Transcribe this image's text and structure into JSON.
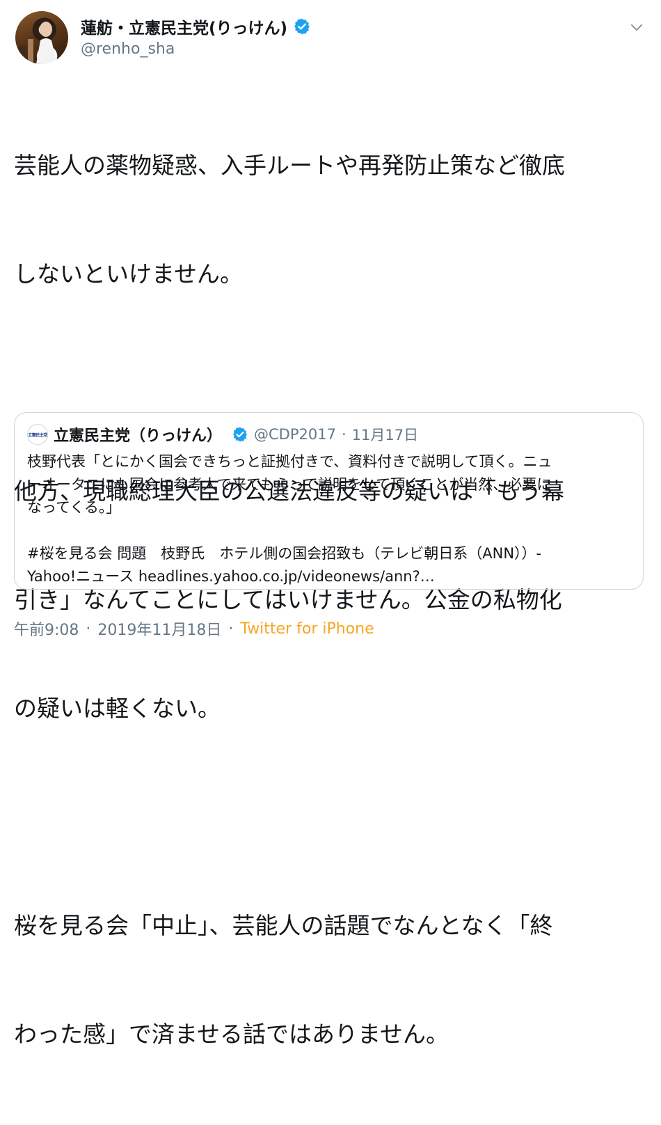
{
  "author": {
    "display_name": "蓮舫・立憲民主党(りっけん)",
    "handle": "@renho_sha"
  },
  "tweet": {
    "paragraphs": [
      [
        "芸能人の薬物疑惑、入手ルートや再発防止策など徹底",
        "しないといけません。"
      ],
      [
        "他方、現職総理大臣の公選法違反等の疑いは「もう幕",
        "引き」なんてことにしてはいけません。公金の私物化",
        "の疑いは軽くない。"
      ],
      [
        "桜を見る会「中止」、芸能人の話題でなんとなく「終",
        "わった感」で済ませる話ではありません。"
      ]
    ]
  },
  "quote": {
    "avatar_text": "立憲民主党",
    "display_name": "立憲民主党（りっけん）",
    "handle": "@CDP2017",
    "separator": "·",
    "date": "11月17日",
    "lines": [
      "枝野代表「とにかく国会できちっと証拠付きで、資料付きで説明して頂く。ニュ",
      "ーオータニにも国会に参考人で来てもらって説明をして頂くことが当然、必要に",
      "なってくる。」",
      "",
      "#桜を見る会 問題　枝野氏　ホテル側の国会招致も（テレビ朝日系（ANN））‐",
      "Yahoo!ニュース headlines.yahoo.co.jp/videonews/ann?…"
    ]
  },
  "footer": {
    "time": "午前9:08",
    "separator": "·",
    "date": "2019年11月18日",
    "separator2": "·",
    "source": "Twitter for iPhone"
  },
  "icons": {
    "verified": "verified-badge-icon",
    "caret": "chevron-down-icon"
  },
  "colors": {
    "text": "#14171a",
    "secondary": "#657786",
    "verified_blue": "#1da1f2",
    "source_link": "#f5a623",
    "border": "#ccd6dd"
  }
}
